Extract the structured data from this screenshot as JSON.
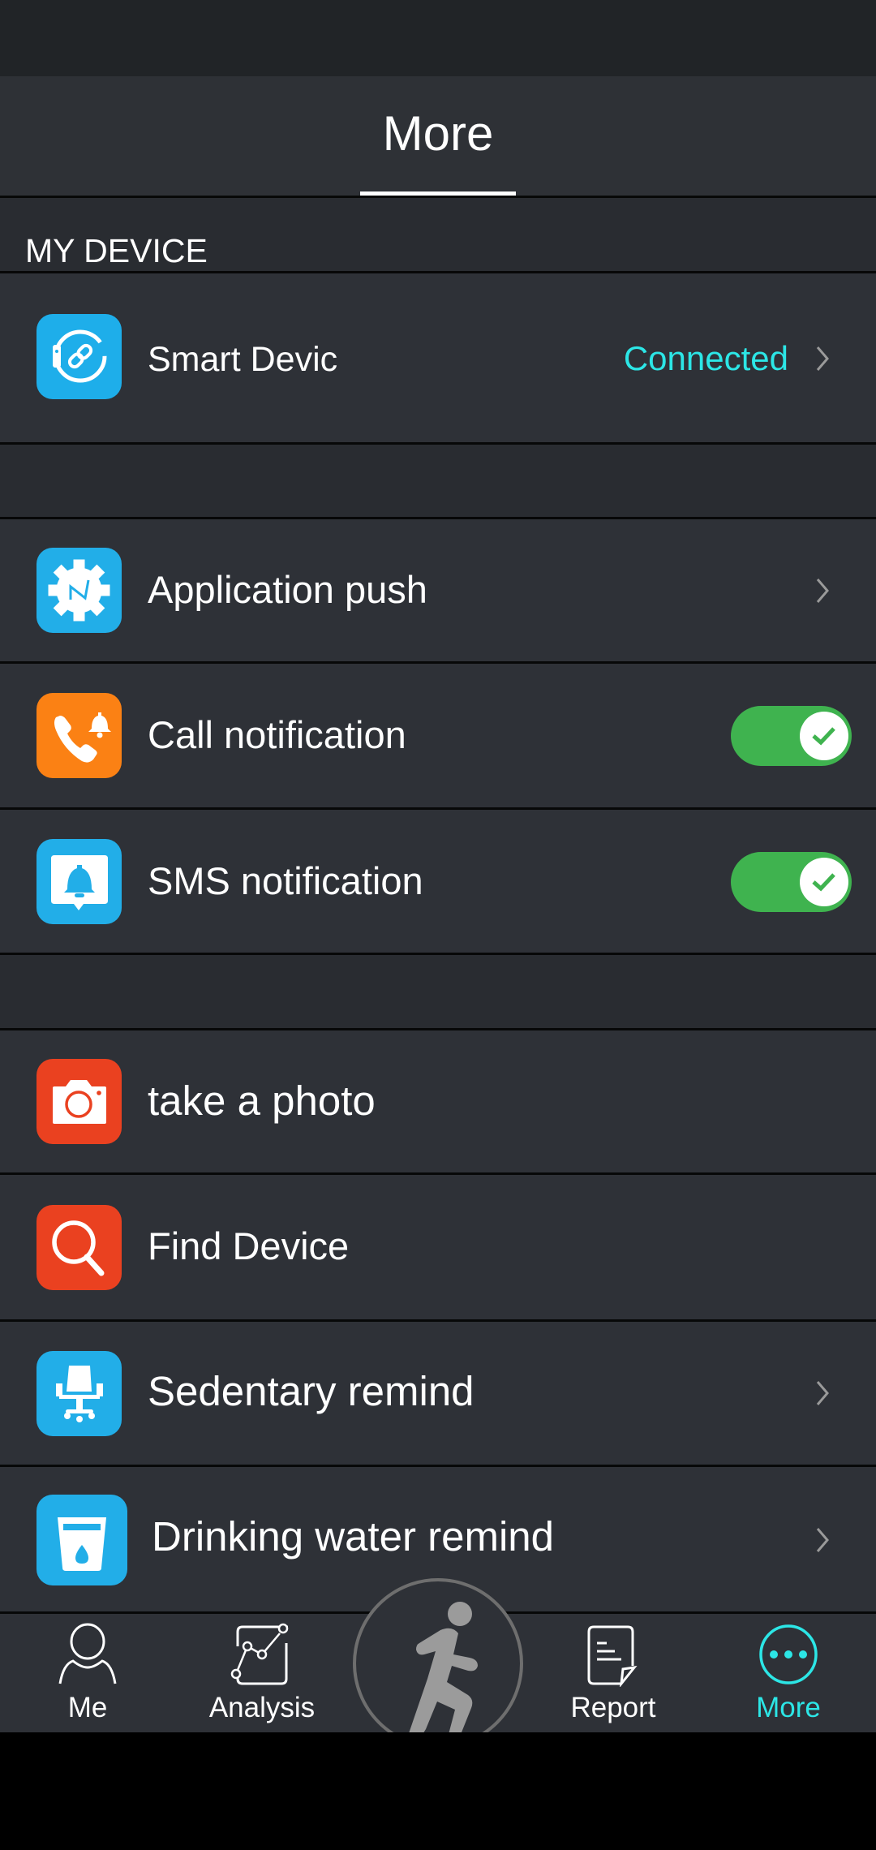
{
  "header": {
    "title": "More"
  },
  "section": {
    "title": "MY DEVICE"
  },
  "device": {
    "label": "Smart Devic",
    "status": "Connected",
    "icon": "watch-link-icon"
  },
  "group1": [
    {
      "label": "Application push",
      "icon": "gear-push-icon",
      "control": "chevron"
    },
    {
      "label": "Call notification",
      "icon": "phone-bell-icon",
      "control": "toggle",
      "enabled": true
    },
    {
      "label": "SMS notification",
      "icon": "message-bell-icon",
      "control": "toggle",
      "enabled": true
    }
  ],
  "group2": [
    {
      "label": "take a photo",
      "icon": "camera-icon",
      "control": "none"
    },
    {
      "label": "Find Device",
      "icon": "search-icon",
      "control": "none"
    },
    {
      "label": "Sedentary remind",
      "icon": "office-chair-icon",
      "control": "chevron"
    },
    {
      "label": "Drinking water remind",
      "icon": "water-glass-icon",
      "control": "chevron"
    }
  ],
  "nav": {
    "items": [
      {
        "label": "Me",
        "icon": "person-icon",
        "active": false
      },
      {
        "label": "Analysis",
        "icon": "line-chart-icon",
        "active": false
      },
      {
        "label": "",
        "icon": "runner-icon",
        "active": false
      },
      {
        "label": "Report",
        "icon": "document-icon",
        "active": false
      },
      {
        "label": "More",
        "icon": "more-dots-icon",
        "active": true
      }
    ]
  },
  "colors": {
    "accent": "#2ce6e6",
    "toggle_on": "#3fb34f",
    "icon_blue": "#22aee8",
    "icon_orange": "#fb8114",
    "icon_red": "#ea4120"
  }
}
